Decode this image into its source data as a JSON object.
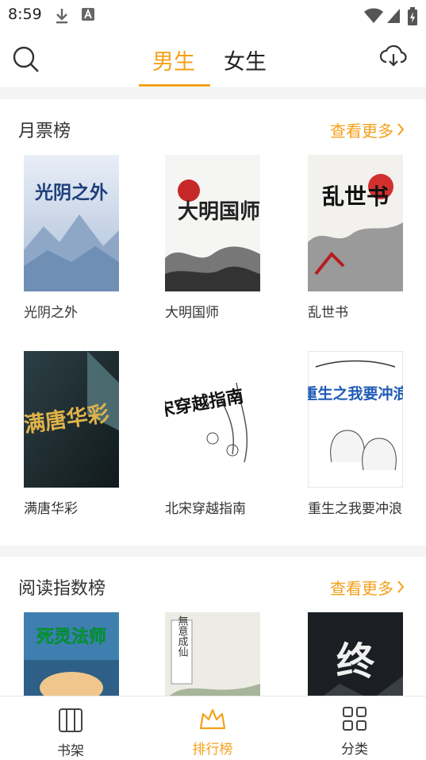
{
  "status_bar": {
    "time": "8:59"
  },
  "top_nav": {
    "tabs": [
      {
        "label": "男生",
        "active": true
      },
      {
        "label": "女生",
        "active": false
      }
    ],
    "accent_color": "#f5a019"
  },
  "sections": [
    {
      "title": "月票榜",
      "more_label": "查看更多",
      "books": [
        {
          "title": "光阴之外",
          "cover_text": "光阴之外"
        },
        {
          "title": "大明国师",
          "cover_text": "大明国师"
        },
        {
          "title": "乱世书",
          "cover_text": "乱世书"
        },
        {
          "title": "满唐华彩",
          "cover_text": "满唐华彩"
        },
        {
          "title": "北宋穿越指南",
          "cover_text": "北宋穿越指南"
        },
        {
          "title": "重生之我要冲浪",
          "cover_text": "重生之我要冲浪"
        }
      ]
    },
    {
      "title": "阅读指数榜",
      "more_label": "查看更多",
      "books": [
        {
          "title": "死灵法师",
          "cover_text": "死灵法师"
        },
        {
          "title": "無意成仙",
          "cover_text": "無意成仙"
        },
        {
          "title": "终",
          "cover_text": "终"
        }
      ]
    }
  ],
  "bottom_nav": {
    "items": [
      {
        "label": "书架",
        "icon": "bookshelf-icon",
        "active": false
      },
      {
        "label": "排行榜",
        "icon": "crown-icon",
        "active": true
      },
      {
        "label": "分类",
        "icon": "grid-icon",
        "active": false
      }
    ]
  }
}
